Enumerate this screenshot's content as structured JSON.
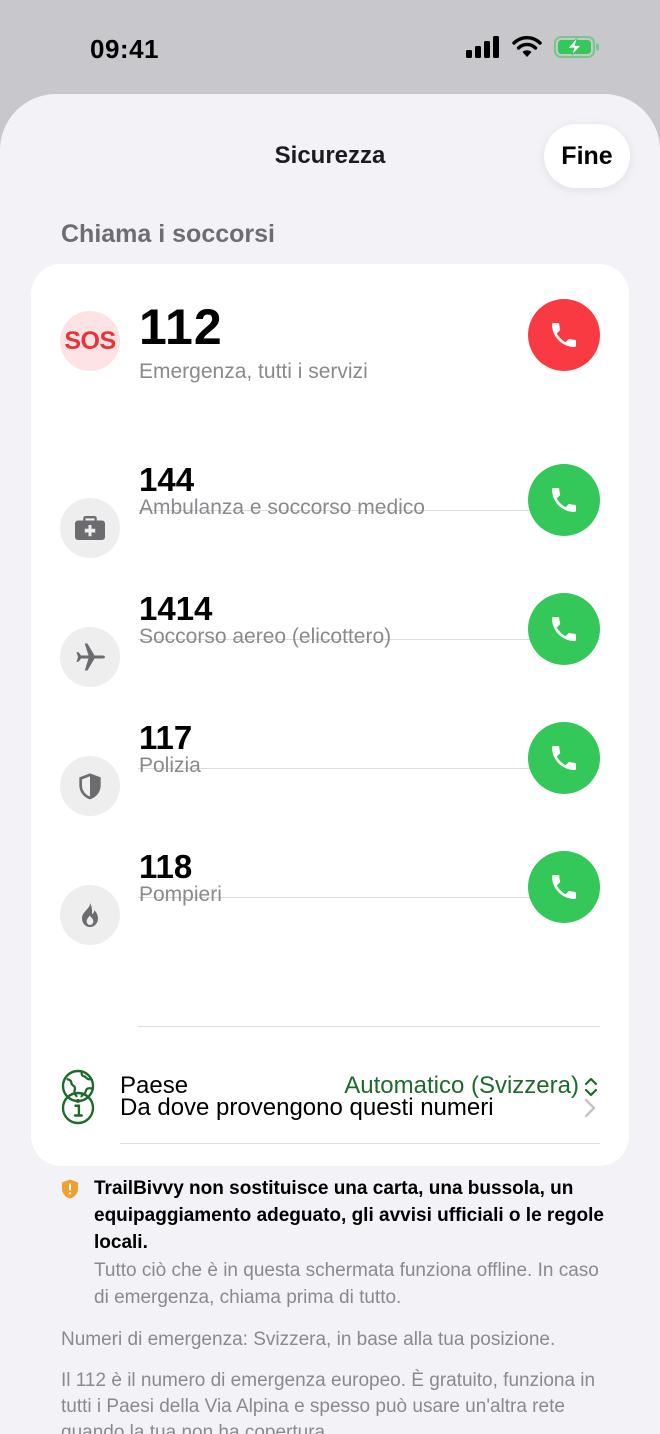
{
  "status": {
    "time": "09:41",
    "colors": {
      "battery": "#34c759"
    }
  },
  "sheet": {
    "title": "Sicurezza",
    "done_label": "Fine"
  },
  "section": {
    "header": "Chiama i soccorsi"
  },
  "contacts": [
    {
      "icon": "sos-icon",
      "icon_text": "SOS",
      "number": "112",
      "description": "Emergenza, tutti i servizi",
      "call_color": "#fa3a42"
    },
    {
      "icon": "medical-kit-icon",
      "number": "144",
      "description": "Ambulanza e soccorso medico",
      "call_color": "#34c759"
    },
    {
      "icon": "airplane-icon",
      "number": "1414",
      "description": "Soccorso aereo (elicottero)",
      "call_color": "#34c759"
    },
    {
      "icon": "shield-icon",
      "number": "117",
      "description": "Polizia",
      "call_color": "#34c759"
    },
    {
      "icon": "flame-icon",
      "number": "118",
      "description": "Pompieri",
      "call_color": "#34c759"
    }
  ],
  "country": {
    "label": "Paese",
    "value": "Automatico (Svizzera)",
    "icon": "globe-icon"
  },
  "source": {
    "label": "Da dove provengono questi numeri",
    "icon": "info-icon"
  },
  "notice": {
    "bold": "TrailBivvy non sostituisce una carta, una bussola, un equipaggiamento adeguato, gli avvisi ufficiali o le regole locali.",
    "sub": "Tutto ciò che è in questa schermata funziona offline. In caso di emergenza, chiama prima di tutto."
  },
  "footer": {
    "line1": "Numeri di emergenza: Svizzera, in base alla tua posizione.",
    "line2": "Il 112 è il numero di emergenza europeo. È gratuito, funziona in tutti i Paesi della Via Alpina e spesso può usare un'altra rete quando la tua non ha copertura."
  },
  "colors": {
    "accent_green": "#1f6a2b",
    "call_green": "#34c759",
    "call_red": "#fa3a42",
    "warning_orange": "#f0a030"
  }
}
